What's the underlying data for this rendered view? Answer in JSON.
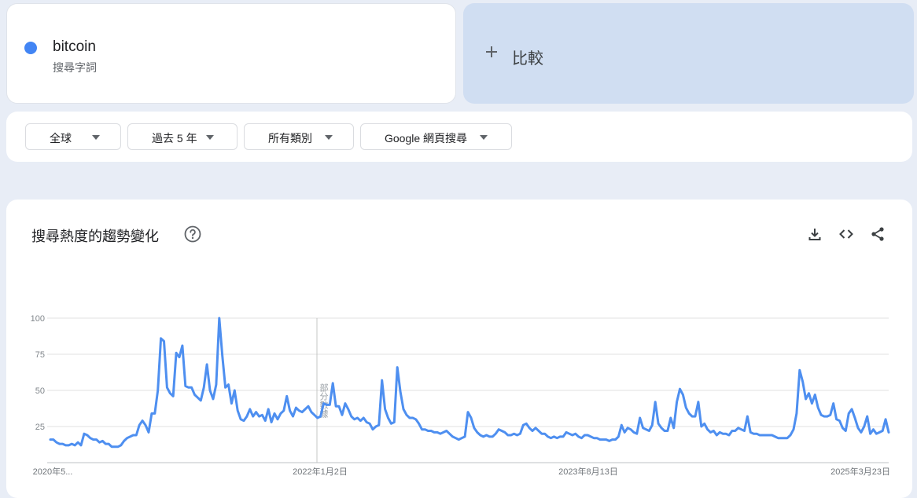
{
  "term": {
    "name": "bitcoin",
    "subtitle": "搜尋字詞",
    "color": "#4285f4"
  },
  "compare": {
    "label": "比較"
  },
  "filters": [
    {
      "label": "全球"
    },
    {
      "label": "過去 5 年"
    },
    {
      "label": "所有類別"
    },
    {
      "label": "Google 網頁搜尋"
    }
  ],
  "chart_section": {
    "title": "搜尋熱度的趨勢變化"
  },
  "icons": {
    "help": "help-circle-icon",
    "download": "download-icon",
    "embed": "code-icon",
    "share": "share-icon"
  },
  "chart_data": {
    "type": "line",
    "title": "",
    "y_ticks": [
      "25",
      "50",
      "75",
      "100"
    ],
    "ylim": [
      0,
      100
    ],
    "x_tick_labels": [
      "2020年5...",
      "2022年1月2日",
      "2023年8月13日",
      "2025年3月23日"
    ],
    "partial_label": "部分數據",
    "grid": true,
    "series": [
      {
        "color": "#4e8ff0",
        "values": [
          16,
          16,
          14,
          13,
          13,
          12,
          12,
          13,
          12,
          14,
          12,
          20,
          19,
          17,
          16,
          16,
          14,
          15,
          13,
          13,
          11,
          11,
          11,
          12,
          15,
          17,
          18,
          19,
          19,
          26,
          29,
          26,
          21,
          34,
          34,
          50,
          86,
          84,
          52,
          48,
          46,
          76,
          73,
          81,
          53,
          52,
          52,
          47,
          45,
          43,
          52,
          68,
          50,
          44,
          54,
          100,
          74,
          52,
          54,
          41,
          50,
          36,
          30,
          29,
          32,
          37,
          32,
          35,
          32,
          33,
          29,
          37,
          28,
          34,
          30,
          34,
          36,
          46,
          36,
          32,
          38,
          36,
          35,
          37,
          39,
          35,
          33,
          31,
          32,
          41,
          40,
          40,
          55,
          39,
          39,
          33,
          41,
          37,
          32,
          30,
          31,
          29,
          31,
          28,
          27,
          23,
          25,
          26,
          57,
          37,
          31,
          27,
          28,
          66,
          49,
          37,
          33,
          31,
          31,
          30,
          27,
          23,
          23,
          22,
          22,
          21,
          21,
          20,
          21,
          22,
          20,
          18,
          17,
          16,
          17,
          18,
          35,
          31,
          24,
          21,
          19,
          18,
          19,
          18,
          18,
          20,
          23,
          22,
          21,
          19,
          19,
          20,
          19,
          20,
          26,
          27,
          24,
          22,
          24,
          22,
          20,
          20,
          18,
          17,
          18,
          17,
          18,
          18,
          21,
          20,
          19,
          20,
          18,
          17,
          19,
          19,
          18,
          17,
          17,
          16,
          16,
          16,
          15,
          16,
          16,
          18,
          26,
          21,
          24,
          23,
          21,
          20,
          31,
          24,
          23,
          22,
          26,
          42,
          27,
          24,
          22,
          22,
          31,
          24,
          42,
          51,
          47,
          38,
          34,
          32,
          32,
          42,
          25,
          27,
          23,
          21,
          22,
          19,
          21,
          20,
          20,
          19,
          22,
          22,
          24,
          23,
          22,
          32,
          21,
          20,
          20,
          19,
          19,
          19,
          19,
          19,
          18,
          17,
          17,
          17,
          17,
          19,
          23,
          34,
          64,
          56,
          44,
          48,
          41,
          47,
          38,
          33,
          32,
          32,
          33,
          41,
          30,
          29,
          24,
          22,
          34,
          37,
          31,
          24,
          21,
          25,
          32,
          20,
          23,
          20,
          21,
          22,
          30,
          21
        ]
      }
    ]
  }
}
